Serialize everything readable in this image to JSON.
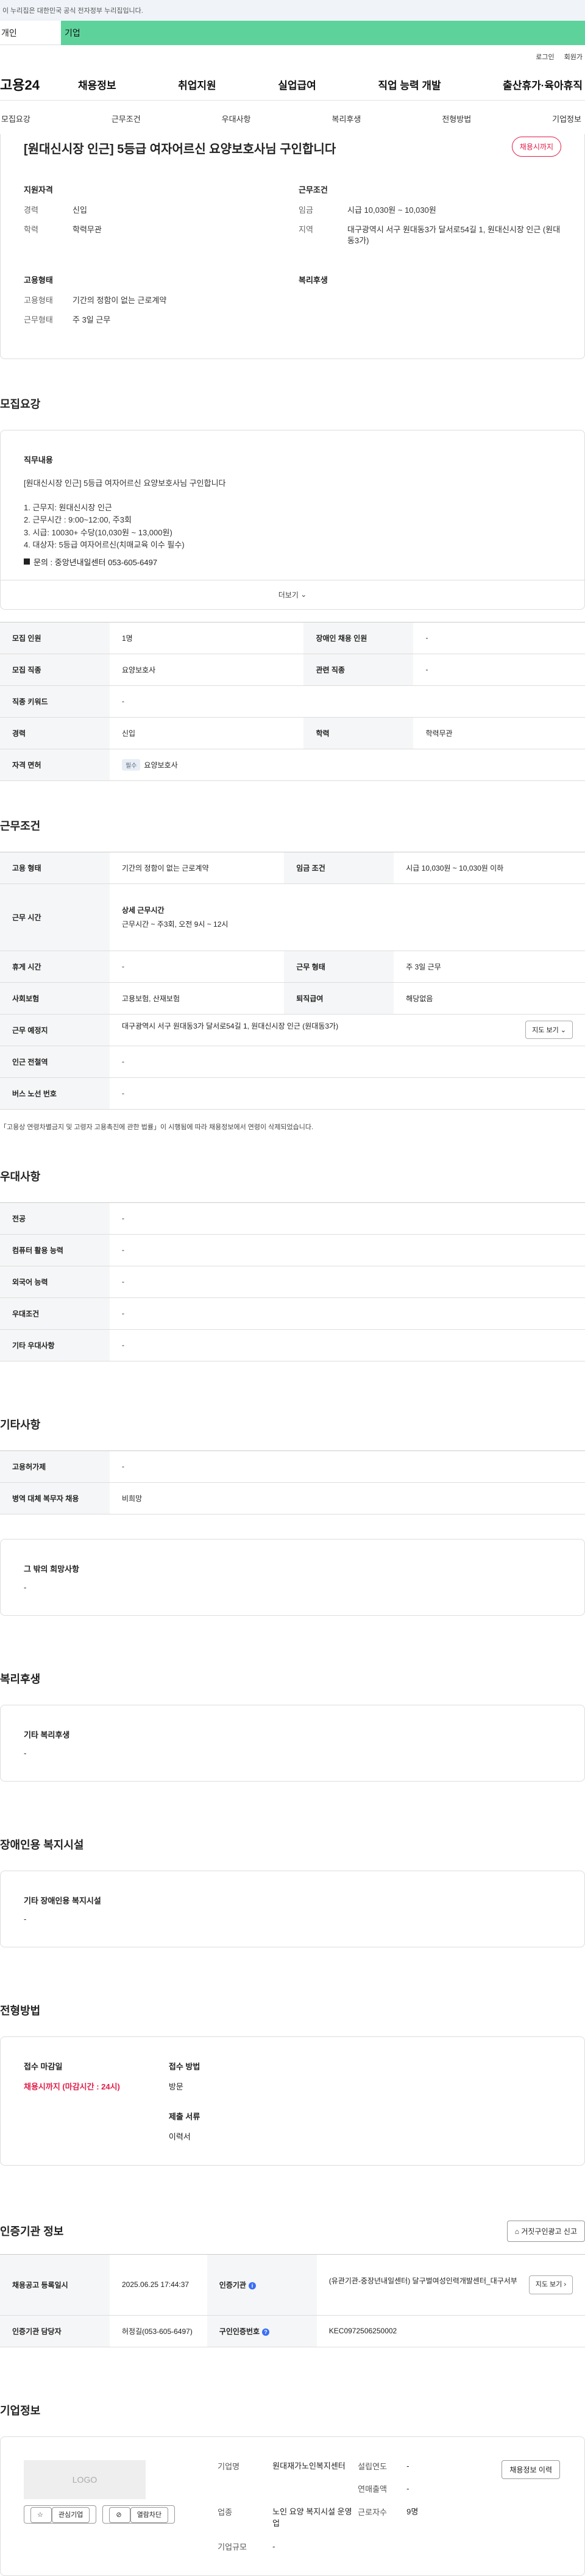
{
  "gov_bar": "이 누리집은 대한민국 공식 전자정부 누리집입니다.",
  "audience": {
    "person": "개인",
    "company": "기업"
  },
  "util": {
    "login": "로그인",
    "join": "회원가"
  },
  "logo": "고용24",
  "gnb": [
    "채용정보",
    "취업지원",
    "실업급여",
    "직업 능력 개발",
    "출산휴가·육아휴직"
  ],
  "subtabs": [
    "모집요강",
    "근무조건",
    "우대사항",
    "복리후생",
    "전형방법",
    "기업정보"
  ],
  "summary": {
    "title": "[원대신시장 인근] 5등급 여자어르신 요양보호사님 구인합니다",
    "deadline": "채용시까지",
    "qual_title": "지원자격",
    "qual": [
      {
        "k": "경력",
        "v": "신입"
      },
      {
        "k": "학력",
        "v": "학력무관"
      }
    ],
    "cond_title": "근무조건",
    "cond": [
      {
        "k": "임금",
        "v": "시급 10,030원 ~ 10,030원"
      },
      {
        "k": "지역",
        "v": "대구광역시 서구 원대동3가 달서로54길 1, 원대신시장 인근 (원대동3가)"
      }
    ],
    "emp_title": "고용형태",
    "emp": [
      {
        "k": "고용형태",
        "v": "기간의 정함이 없는 근로계약"
      },
      {
        "k": "근무형태",
        "v": "주 3일 근무"
      }
    ],
    "welfare_title": "복리후생"
  },
  "recruit": {
    "title": "모집요강",
    "duty_title": "직무내용",
    "duty_text": "[원대신시장 인근] 5등급 여자어르신 요양보호사님 구인합니다\n\n1. 근무지: 원대신시장 인근\n2. 근무시간 : 9:00~12:00, 주3회\n3. 시급: 10030+ 수당(10,030원 ~ 13,000원)\n4. 대상자: 5등급 여자어르신(치매교육 이수 필수)",
    "contact": "문의 : 중앙년내일센터 053-605-6497",
    "more": "더보기",
    "rows": [
      {
        "h1": "모집 인원",
        "v1": "1명",
        "h2": "장애인 채용 인원",
        "v2": "-"
      },
      {
        "h1": "모집 직종",
        "v1": "요양보호사",
        "h2": "관련 직종",
        "v2": "-"
      },
      {
        "h1": "직종 키워드",
        "v1": "-"
      },
      {
        "h1": "경력",
        "v1": "신입",
        "h2": "학력",
        "v2": "학력무관"
      }
    ],
    "license_h": "자격 면허",
    "license_tag": "필수",
    "license_v": "요양보호사"
  },
  "work": {
    "title": "근무조건",
    "emp_h": "고용 형태",
    "emp_v": "기간의 정함이 없는 근로계약",
    "wage_h": "임금 조건",
    "wage_v": "시급 10,030원 ~ 10,030원 이하",
    "time_h": "근무 시간",
    "time_sub": "상세 근무시간",
    "time_v": "근무시간 ~ 주3회, 오전 9시 ~ 12시",
    "rest_h": "휴게 시간",
    "rest_v": "-",
    "form_h": "근무 형태",
    "form_v": "주 3일 근무",
    "ins_h": "사회보험",
    "ins_v": "고용보험, 산재보험",
    "sev_h": "퇴직급여",
    "sev_v": "해당없음",
    "place_h": "근무 예정지",
    "place_v": "대구광역시 서구 원대동3가 달서로54길 1, 원대신시장 인근 (원대동3가)",
    "map_btn": "지도 보기",
    "subway_h": "인근 전철역",
    "subway_v": "-",
    "bus_h": "버스 노선 번호",
    "bus_v": "-",
    "note": "「고용상 연령차별금지 및 고령자 고용촉진에 관한 법률」이 시행됨에 따라 채용정보에서 연령이 삭제되었습니다."
  },
  "pref": {
    "title": "우대사항",
    "rows": [
      {
        "h": "전공",
        "v": "-"
      },
      {
        "h": "컴퓨터 활용 능력",
        "v": "-"
      },
      {
        "h": "외국어 능력",
        "v": "-"
      },
      {
        "h": "우대조건",
        "v": "-"
      },
      {
        "h": "기타 우대사항",
        "v": "-"
      }
    ]
  },
  "etc": {
    "title": "기타사항",
    "rows": [
      {
        "h": "고용허가제",
        "v": "-"
      },
      {
        "h": "병역 대체 복무자 채용",
        "v": "비희망"
      }
    ],
    "box_title": "그 밖의 희망사항",
    "box_v": "-"
  },
  "welfare": {
    "title": "복리후생",
    "box_title": "기타 복리후생",
    "box_v": "-"
  },
  "disability": {
    "title": "장애인용 복지시설",
    "box_title": "기타 장애인용 복지시설",
    "box_v": "-"
  },
  "apply": {
    "title": "전형방법",
    "deadline_h": "접수 마감일",
    "deadline_v": "채용시까지 (마감시간 : 24시)",
    "method_h": "접수 방법",
    "method_v": "방문",
    "doc_h": "제출 서류",
    "doc_v": "이력서"
  },
  "cert": {
    "title": "인증기관 정보",
    "btn": "거짓구인광고 신고",
    "reg_h": "채용공고 등록일시",
    "reg_v": "2025.06.25 17:44:37",
    "org_h": "인증기관",
    "org_v": "(유관기관-중장년내일센터) 달구벌여성인력개발센터_대구서부",
    "map_btn": "지도 보기",
    "mgr_h": "인증기관 담당자",
    "mgr_v": "허정길(053-605-6497)",
    "no_h": "구인인증번호",
    "no_v": "KEC0972506250002"
  },
  "company": {
    "title": "기업정보",
    "logo": "LOGO",
    "fav": "관심기업",
    "block": "열람차단",
    "name_h": "기업명",
    "name_v": "원대재가노인복지센터",
    "year_h": "설립연도",
    "year_v": "-",
    "sales_h": "연매출액",
    "sales_v": "-",
    "ind_h": "업종",
    "ind_v": "노인 요양 복지시설 운영업",
    "emp_h": "근로자수",
    "emp_v": "9명",
    "size_h": "기업규모",
    "size_v": "-",
    "hire_btn": "채용정보 이력"
  }
}
